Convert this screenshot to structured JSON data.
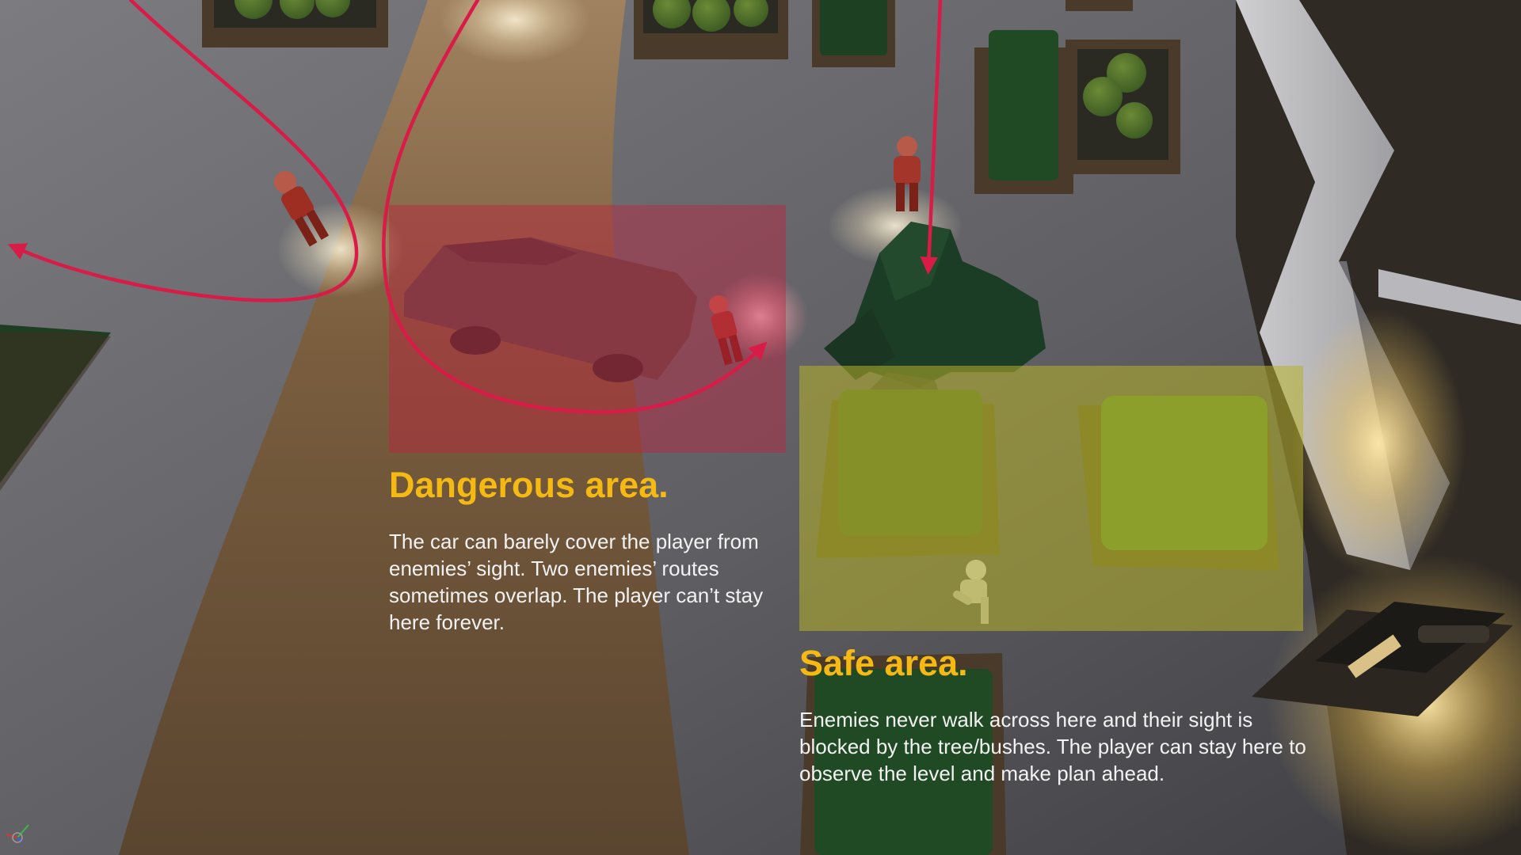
{
  "annotations": {
    "dangerous": {
      "title": "Dangerous area.",
      "description": "The car can barely cover the player from enemies’ sight. Two enemies’ routes sometimes overlap. The player can’t stay here forever."
    },
    "safe": {
      "title": "Safe area.",
      "description": "Enemies never walk across here and their sight is blocked by the tree/bushes. The player can stay here to observe the level and make plan ahead."
    }
  },
  "colors": {
    "heading": "#f5b914",
    "body_text": "#f2f2f2",
    "danger_zone": "#c41f3d",
    "safe_zone": "#b7b12a",
    "patrol_route": "#d81b47",
    "ground": "#6b6b6e",
    "road": "#8a6a44",
    "foliage": "#1f4a23"
  },
  "icons": {
    "patrol_arrow": "arrowhead-icon",
    "axis_gizmo": "xyz-axis-gizmo-icon"
  }
}
